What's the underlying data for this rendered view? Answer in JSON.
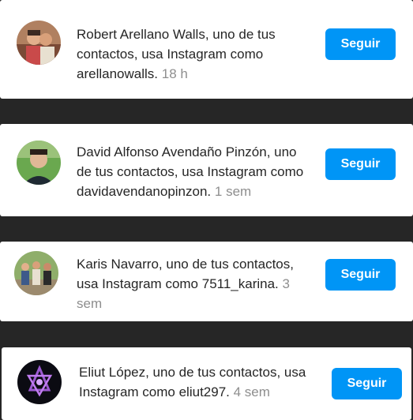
{
  "notifications": [
    {
      "name": "Robert Arellano Walls",
      "text": "Robert Arellano Walls, uno de tus contactos, usa Instagram como arellanowalls.",
      "time": "18 h",
      "button": "Seguir",
      "avatar_icon": "person-photo"
    },
    {
      "name": "David Alfonso Avendaño Pinzón",
      "text": "David Alfonso Avendaño Pinzón, uno de tus contactos, usa Instagram como davidavendanopinzon.",
      "time": "1 sem",
      "button": "Seguir",
      "avatar_icon": "person-photo"
    },
    {
      "name": "Karis Navarro",
      "text": "Karis Navarro, uno de tus contactos, usa Instagram como 7511_karina.",
      "time": "3 sem",
      "button": "Seguir",
      "avatar_icon": "group-photo"
    },
    {
      "name": "Eliut López",
      "text": "Eliut López, uno de tus contactos, usa Instagram como eliut297.",
      "time": "4 sem",
      "button": "Seguir",
      "avatar_icon": "purple-logo"
    }
  ],
  "colors": {
    "background": "#262626",
    "card": "#ffffff",
    "button": "#0095f6",
    "text": "#262626",
    "time": "#8e8e8e"
  }
}
